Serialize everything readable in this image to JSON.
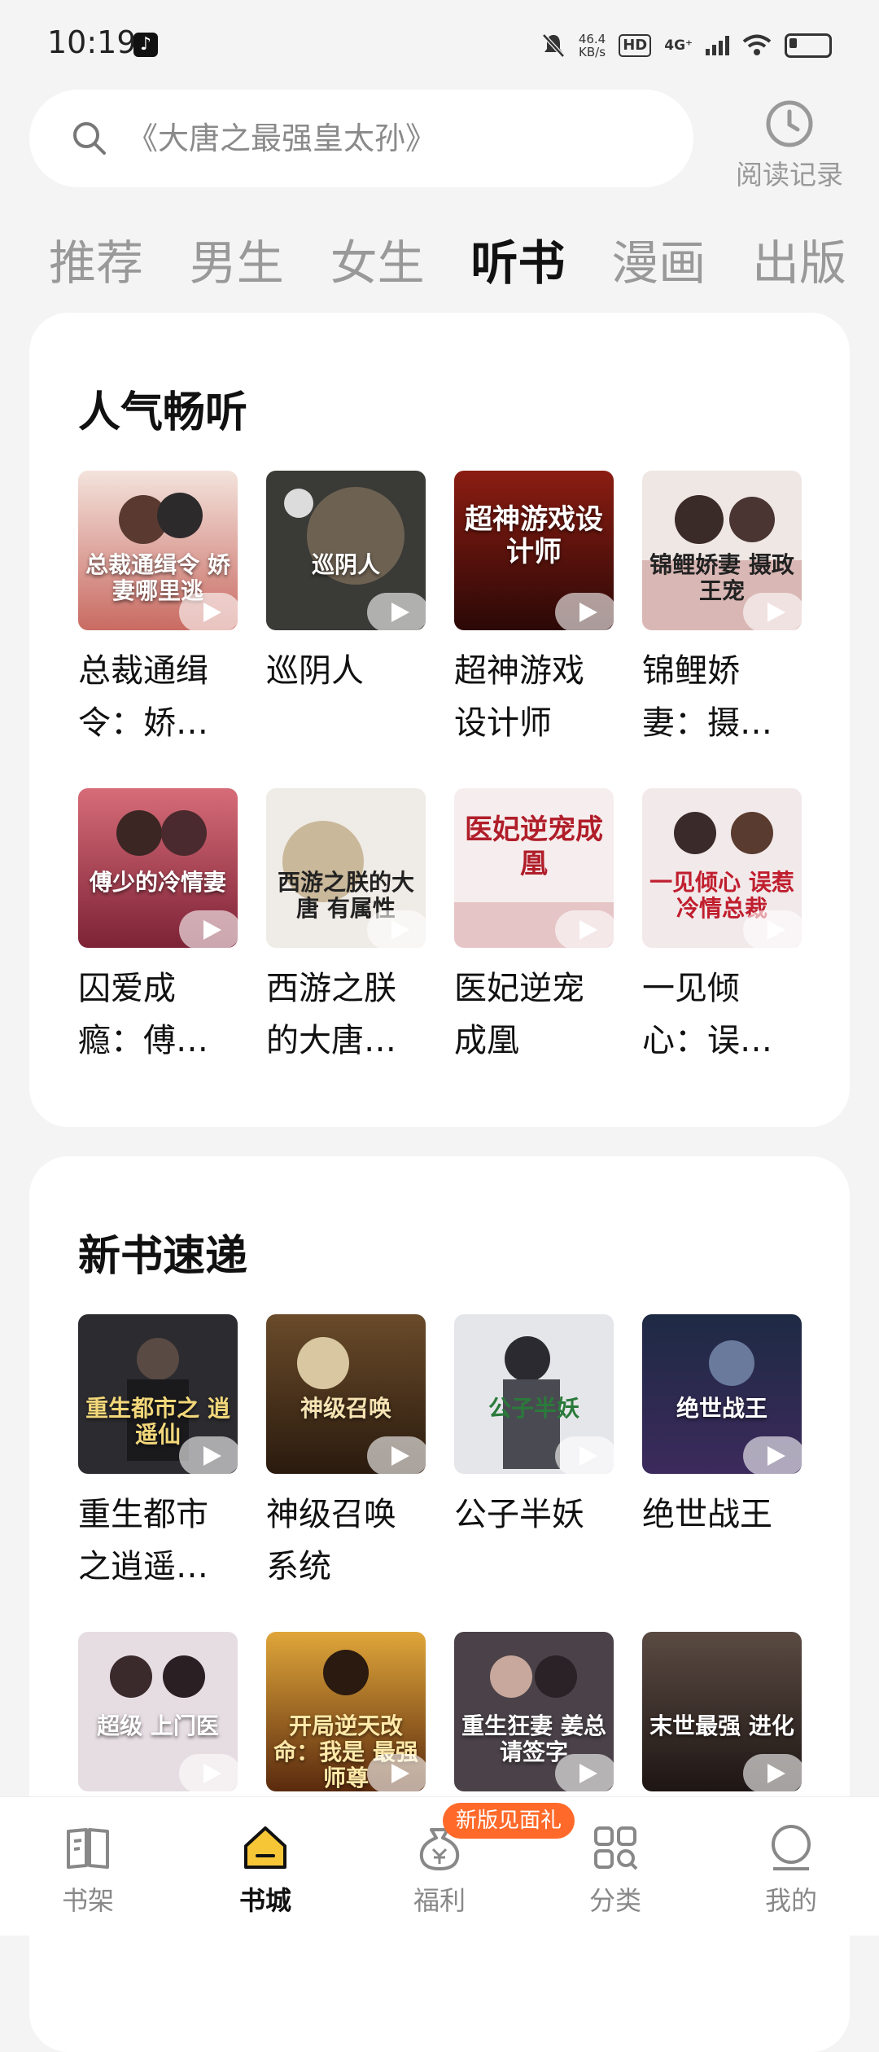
{
  "status": {
    "time": "10:19",
    "speed": "46.4\nKB/s",
    "hd": "HD",
    "network": "4G⁺"
  },
  "search": {
    "placeholder": "《大唐之最强皇太孙》"
  },
  "history": {
    "label": "阅读记录"
  },
  "tabs": [
    {
      "label": "推荐"
    },
    {
      "label": "男生"
    },
    {
      "label": "女生"
    },
    {
      "label": "听书"
    },
    {
      "label": "漫画"
    },
    {
      "label": "出版"
    }
  ],
  "popular": {
    "title": "人气畅听",
    "books": [
      {
        "name": "总裁通缉令：娇…",
        "cover_text": "总裁通缉令 娇妻哪里逃"
      },
      {
        "name": "巡阴人",
        "cover_text": "巡阴人"
      },
      {
        "name": "超神游戏设计师",
        "cover_text": "超神游戏设计师"
      },
      {
        "name": "锦鲤娇妻：摄…",
        "cover_text": "锦鲤娇妻 摄政王宠"
      },
      {
        "name": "囚爱成瘾：傅…",
        "cover_text": "傅少的冷情妻"
      },
      {
        "name": "西游之朕的大唐…",
        "cover_text": "西游之朕的大唐 有属性"
      },
      {
        "name": "医妃逆宠成凰",
        "cover_text": "医妃逆宠成凰"
      },
      {
        "name": "一见倾心：误…",
        "cover_text": "一见倾心 误惹冷情总裁"
      }
    ]
  },
  "newbooks": {
    "title": "新书速递",
    "books": [
      {
        "name": "重生都市之逍遥…",
        "cover_text": "重生都市之 逍遥仙"
      },
      {
        "name": "神级召唤系统",
        "cover_text": "神级召唤"
      },
      {
        "name": "公子半妖",
        "cover_text": "公子半妖"
      },
      {
        "name": "绝世战王",
        "cover_text": "绝世战王"
      },
      {
        "name": "",
        "cover_text": "超级 上门医"
      },
      {
        "name": "",
        "cover_text": "开局逆天改命：我是 最强师尊"
      },
      {
        "name": "",
        "cover_text": "重生狂妻 姜总请签字"
      },
      {
        "name": "",
        "cover_text": "末世最强 进化"
      }
    ]
  },
  "nav": {
    "items": [
      {
        "label": "书架"
      },
      {
        "label": "书城"
      },
      {
        "label": "福利"
      },
      {
        "label": "分类"
      },
      {
        "label": "我的"
      }
    ],
    "promo": "新版见面礼"
  },
  "colors": {
    "accent": "#ff6a2a",
    "active_tab": "#111111",
    "inactive_tab": "#999999"
  }
}
